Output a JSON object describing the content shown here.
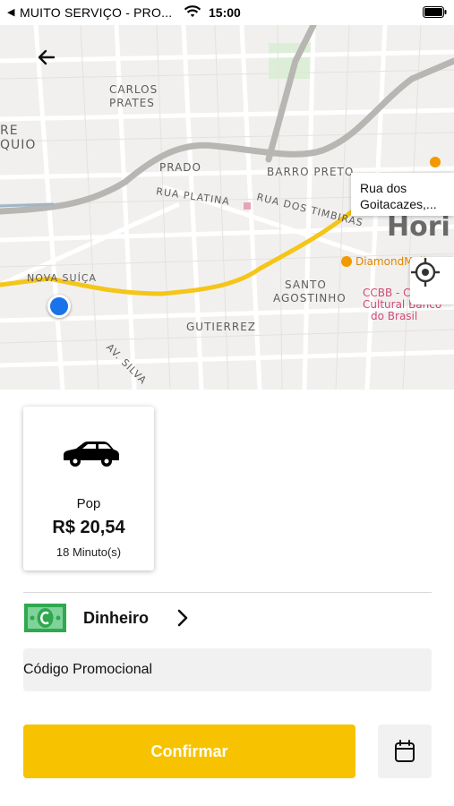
{
  "status_bar": {
    "back_glyph": "◀",
    "carrier": "MUITO SERVIÇO - PRO...",
    "time": "15:00",
    "icons": [
      "wifi-icon",
      "battery-icon"
    ]
  },
  "map": {
    "labels": {
      "carlos_prates_1": "CARLOS",
      "carlos_prates_2": "PRATES",
      "prado": "PRADO",
      "barro_preto": "BARRO PRETO",
      "rua_platina": "RUA PLATINA",
      "rua_dos_timbiras": "RUA DOS TIMBIRAS",
      "santo_agostinho_1": "SANTO",
      "santo_agostinho_2": "AGOSTINHO",
      "gutierrez": "GUTIERREZ",
      "nova_suica": "NOVA SUÍÇA",
      "av_silva": "AV. SILVA",
      "diamond_mall": "DiamondMall",
      "ccbb_1": "CCBB - C",
      "ccbb_2": "Cultural Banco",
      "ccbb_3": "do Brasil",
      "hori": "Hori",
      "re": "RE",
      "quio": "QUIO"
    },
    "destination_address": "Rua dos Goitacazes,...",
    "route_color": "#f5c518",
    "origin_color": "#1a73e8"
  },
  "ride_option": {
    "name": "Pop",
    "price": "R$ 20,54",
    "eta": "18 Minuto(s)",
    "icon": "car-icon"
  },
  "payment": {
    "method": "Dinheiro",
    "icon": "cash-icon"
  },
  "promo": {
    "label": "Código Promocional"
  },
  "actions": {
    "confirm_label": "Confirmar",
    "confirm_color": "#f7c200",
    "schedule_icon": "calendar-icon"
  }
}
